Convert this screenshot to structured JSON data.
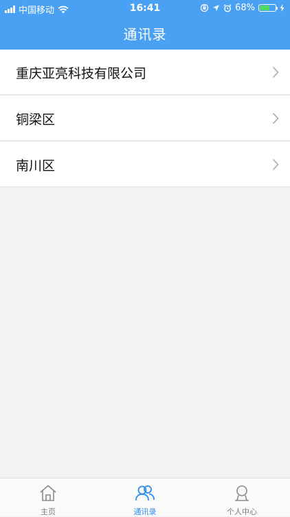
{
  "status_bar": {
    "carrier": "中国移动",
    "time": "16:41",
    "battery_percent": "68%",
    "battery_level": 0.68
  },
  "header": {
    "title": "通讯录"
  },
  "list": {
    "items": [
      {
        "label": "重庆亚亮科技有限公司"
      },
      {
        "label": "铜梁区"
      },
      {
        "label": "南川区"
      }
    ]
  },
  "tabbar": {
    "tabs": [
      {
        "label": "主页",
        "icon": "home-icon"
      },
      {
        "label": "通讯录",
        "icon": "contacts-icon",
        "active": true
      },
      {
        "label": "个人中心",
        "icon": "person-icon"
      }
    ]
  },
  "colors": {
    "header_bg": "#4aa1f3",
    "active_tab": "#2f8df0",
    "inactive_tab": "#7b7b7b",
    "page_bg": "#f2f3f5"
  }
}
